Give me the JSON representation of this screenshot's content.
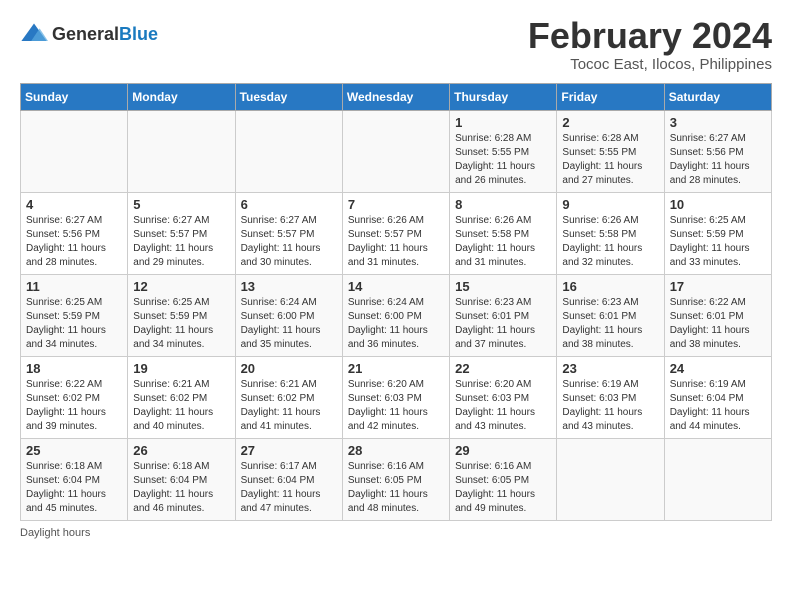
{
  "logo": {
    "general": "General",
    "blue": "Blue"
  },
  "title": "February 2024",
  "subtitle": "Tococ East, Ilocos, Philippines",
  "days_of_week": [
    "Sunday",
    "Monday",
    "Tuesday",
    "Wednesday",
    "Thursday",
    "Friday",
    "Saturday"
  ],
  "footer": "Daylight hours",
  "weeks": [
    [
      {
        "day": "",
        "info": ""
      },
      {
        "day": "",
        "info": ""
      },
      {
        "day": "",
        "info": ""
      },
      {
        "day": "",
        "info": ""
      },
      {
        "day": "1",
        "info": "Sunrise: 6:28 AM\nSunset: 5:55 PM\nDaylight: 11 hours and 26 minutes."
      },
      {
        "day": "2",
        "info": "Sunrise: 6:28 AM\nSunset: 5:55 PM\nDaylight: 11 hours and 27 minutes."
      },
      {
        "day": "3",
        "info": "Sunrise: 6:27 AM\nSunset: 5:56 PM\nDaylight: 11 hours and 28 minutes."
      }
    ],
    [
      {
        "day": "4",
        "info": "Sunrise: 6:27 AM\nSunset: 5:56 PM\nDaylight: 11 hours and 28 minutes."
      },
      {
        "day": "5",
        "info": "Sunrise: 6:27 AM\nSunset: 5:57 PM\nDaylight: 11 hours and 29 minutes."
      },
      {
        "day": "6",
        "info": "Sunrise: 6:27 AM\nSunset: 5:57 PM\nDaylight: 11 hours and 30 minutes."
      },
      {
        "day": "7",
        "info": "Sunrise: 6:26 AM\nSunset: 5:57 PM\nDaylight: 11 hours and 31 minutes."
      },
      {
        "day": "8",
        "info": "Sunrise: 6:26 AM\nSunset: 5:58 PM\nDaylight: 11 hours and 31 minutes."
      },
      {
        "day": "9",
        "info": "Sunrise: 6:26 AM\nSunset: 5:58 PM\nDaylight: 11 hours and 32 minutes."
      },
      {
        "day": "10",
        "info": "Sunrise: 6:25 AM\nSunset: 5:59 PM\nDaylight: 11 hours and 33 minutes."
      }
    ],
    [
      {
        "day": "11",
        "info": "Sunrise: 6:25 AM\nSunset: 5:59 PM\nDaylight: 11 hours and 34 minutes."
      },
      {
        "day": "12",
        "info": "Sunrise: 6:25 AM\nSunset: 5:59 PM\nDaylight: 11 hours and 34 minutes."
      },
      {
        "day": "13",
        "info": "Sunrise: 6:24 AM\nSunset: 6:00 PM\nDaylight: 11 hours and 35 minutes."
      },
      {
        "day": "14",
        "info": "Sunrise: 6:24 AM\nSunset: 6:00 PM\nDaylight: 11 hours and 36 minutes."
      },
      {
        "day": "15",
        "info": "Sunrise: 6:23 AM\nSunset: 6:01 PM\nDaylight: 11 hours and 37 minutes."
      },
      {
        "day": "16",
        "info": "Sunrise: 6:23 AM\nSunset: 6:01 PM\nDaylight: 11 hours and 38 minutes."
      },
      {
        "day": "17",
        "info": "Sunrise: 6:22 AM\nSunset: 6:01 PM\nDaylight: 11 hours and 38 minutes."
      }
    ],
    [
      {
        "day": "18",
        "info": "Sunrise: 6:22 AM\nSunset: 6:02 PM\nDaylight: 11 hours and 39 minutes."
      },
      {
        "day": "19",
        "info": "Sunrise: 6:21 AM\nSunset: 6:02 PM\nDaylight: 11 hours and 40 minutes."
      },
      {
        "day": "20",
        "info": "Sunrise: 6:21 AM\nSunset: 6:02 PM\nDaylight: 11 hours and 41 minutes."
      },
      {
        "day": "21",
        "info": "Sunrise: 6:20 AM\nSunset: 6:03 PM\nDaylight: 11 hours and 42 minutes."
      },
      {
        "day": "22",
        "info": "Sunrise: 6:20 AM\nSunset: 6:03 PM\nDaylight: 11 hours and 43 minutes."
      },
      {
        "day": "23",
        "info": "Sunrise: 6:19 AM\nSunset: 6:03 PM\nDaylight: 11 hours and 43 minutes."
      },
      {
        "day": "24",
        "info": "Sunrise: 6:19 AM\nSunset: 6:04 PM\nDaylight: 11 hours and 44 minutes."
      }
    ],
    [
      {
        "day": "25",
        "info": "Sunrise: 6:18 AM\nSunset: 6:04 PM\nDaylight: 11 hours and 45 minutes."
      },
      {
        "day": "26",
        "info": "Sunrise: 6:18 AM\nSunset: 6:04 PM\nDaylight: 11 hours and 46 minutes."
      },
      {
        "day": "27",
        "info": "Sunrise: 6:17 AM\nSunset: 6:04 PM\nDaylight: 11 hours and 47 minutes."
      },
      {
        "day": "28",
        "info": "Sunrise: 6:16 AM\nSunset: 6:05 PM\nDaylight: 11 hours and 48 minutes."
      },
      {
        "day": "29",
        "info": "Sunrise: 6:16 AM\nSunset: 6:05 PM\nDaylight: 11 hours and 49 minutes."
      },
      {
        "day": "",
        "info": ""
      },
      {
        "day": "",
        "info": ""
      }
    ]
  ]
}
